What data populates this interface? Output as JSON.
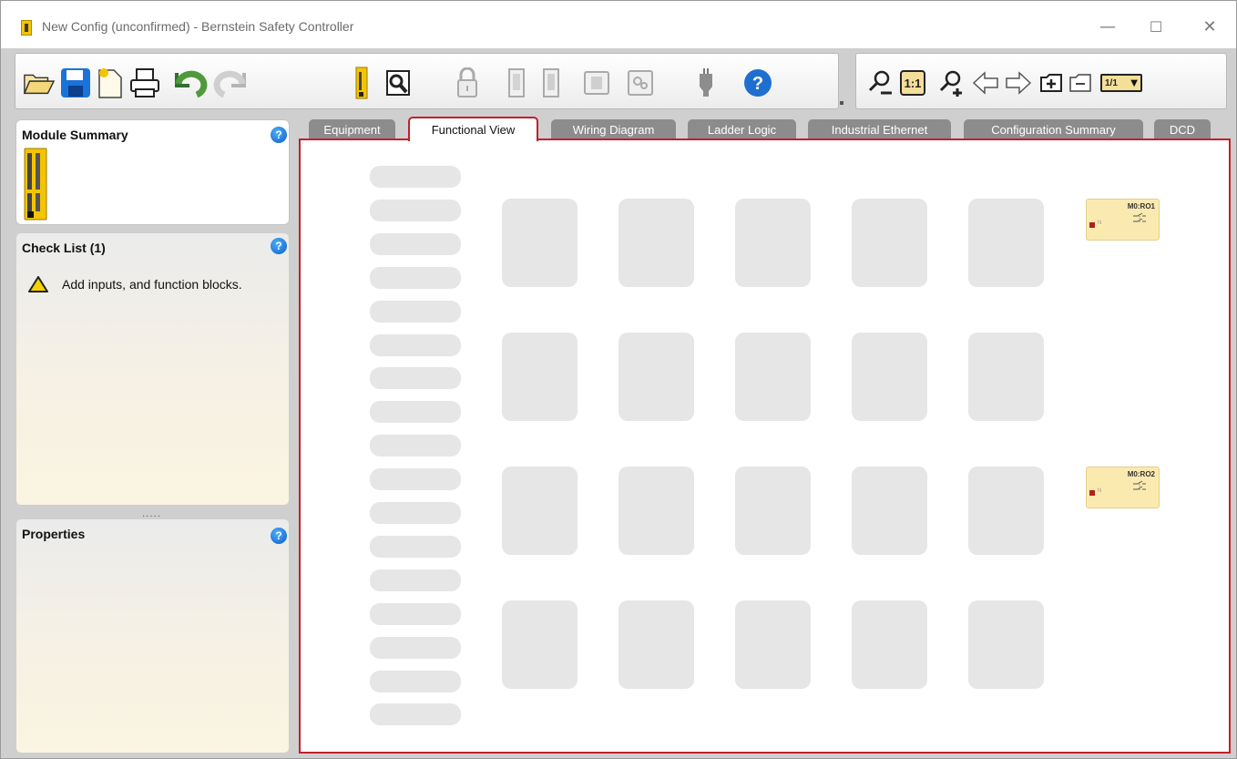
{
  "window": {
    "title": "New Config (unconfirmed) - Bernstein Safety Controller",
    "controls": {
      "minimize": "—",
      "maximize": "☐",
      "close": "✕"
    }
  },
  "toolbar": {
    "left_icons": [
      "open-folder-icon",
      "save-icon",
      "new-config-icon",
      "print-icon",
      "undo-icon",
      "redo-icon",
      "controller-module-icon",
      "inspect-icon",
      "lock-icon",
      "module-a-icon",
      "module-b-icon",
      "module-c-icon",
      "gear-module-icon",
      "plug-icon",
      "help-icon"
    ],
    "right_icons": [
      "zoom-out-icon",
      "zoom-1-1-icon",
      "zoom-in-icon",
      "arrow-left-icon",
      "arrow-right-icon",
      "add-page-icon",
      "remove-page-icon",
      "page-selector"
    ],
    "zoom_reset_label": "1:1",
    "page_selector_value": "1/1"
  },
  "panels": {
    "module_summary": {
      "title": "Module Summary"
    },
    "check_list": {
      "title": "Check List (1)",
      "items": [
        "Add inputs, and function blocks."
      ]
    },
    "properties": {
      "title": "Properties"
    },
    "help_label": "?",
    "splitter_dots": "....."
  },
  "tabs": [
    "Equipment",
    "Functional View",
    "Wiring Diagram",
    "Ladder Logic",
    "Industrial Ethernet",
    "Configuration Summary",
    "DCD"
  ],
  "active_tab": "Functional View",
  "canvas": {
    "input_slot_count": 17,
    "function_block_rows": 4,
    "function_block_cols": 5,
    "outputs": [
      {
        "label": "M0:RO1",
        "indicator": "N"
      },
      {
        "label": "M0:RO2",
        "indicator": "N"
      }
    ]
  },
  "colors": {
    "accent_red": "#c2202a",
    "tab_inactive": "#8c8c8c",
    "placeholder_gray": "#e6e6e6",
    "output_block": "#fbeab0",
    "help_blue": "#0a5cc0"
  }
}
